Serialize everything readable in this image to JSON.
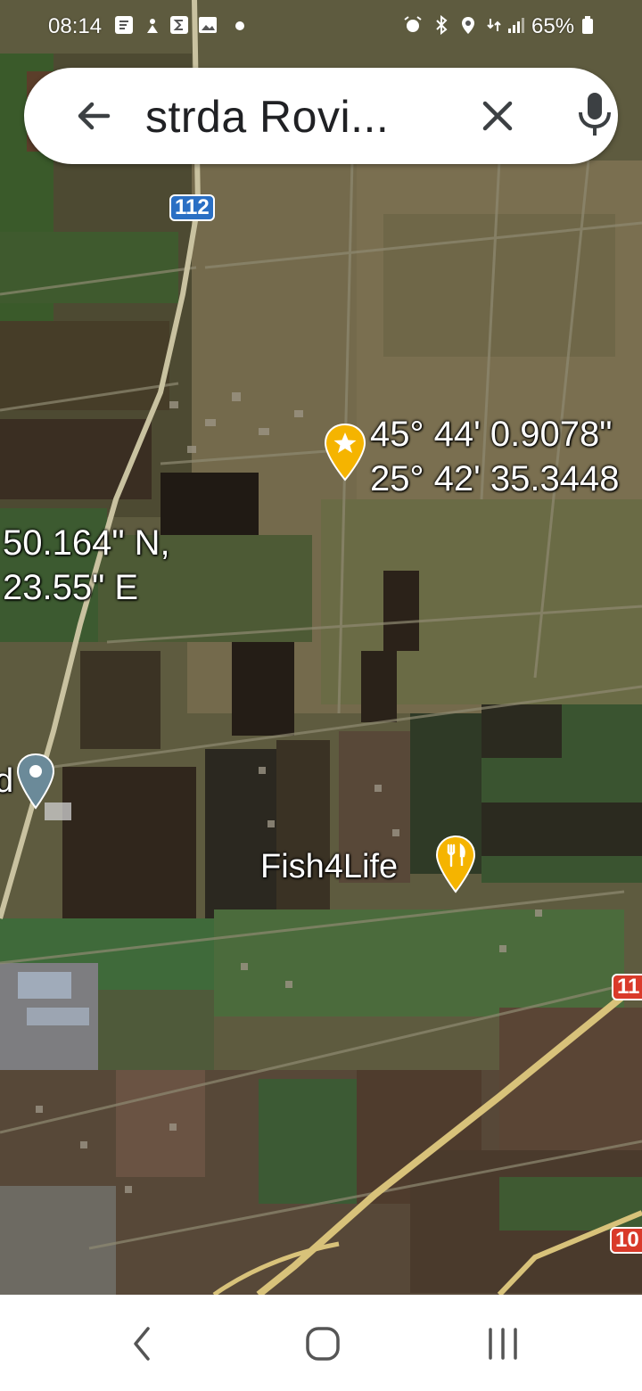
{
  "status_bar": {
    "time": "08:14",
    "battery": "65%"
  },
  "search": {
    "query": "strda Rovi..."
  },
  "map": {
    "road_shields": [
      "112",
      "11",
      "10"
    ],
    "coordinate_labels": {
      "pinned_lat": "45° 44' 0.9078\"",
      "pinned_lon": "25° 42' 35.3448",
      "left_lat": "50.164\" N,",
      "left_lon": "23.55\" E"
    },
    "places": {
      "fish4life": "Fish4Life",
      "partial_left": "d"
    }
  },
  "colors": {
    "accent_pin": "#f5b400",
    "shield_blue": "#2a6fc4",
    "shield_red": "#d93a2a",
    "gray_pin": "#6b8a99"
  }
}
